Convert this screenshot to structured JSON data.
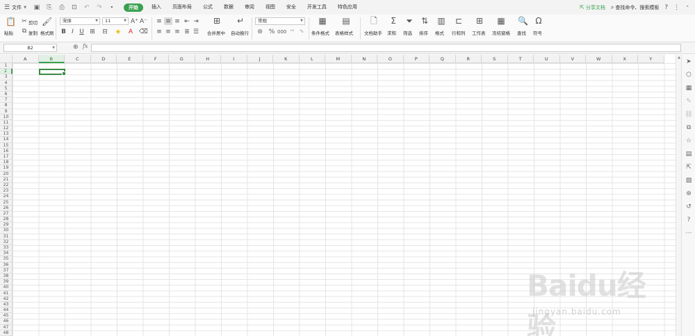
{
  "menubar": {
    "file_label": "文件",
    "tabs": [
      "开始",
      "插入",
      "页面布局",
      "公式",
      "数据",
      "审阅",
      "视图",
      "安全",
      "开发工具",
      "特色应用"
    ],
    "active_tab": "开始",
    "share_label": "分享文档",
    "search_label": "查找命令、搜索模板",
    "help_label": "?"
  },
  "ribbon": {
    "paste_label": "粘贴",
    "cut_label": "剪切",
    "copy_label": "复制",
    "format_painter_label": "格式刷",
    "font_name": "宋体",
    "font_size": "11",
    "merge_center_label": "合并居中",
    "wrap_text_label": "自动换行",
    "number_format": "常规",
    "cond_format_label": "条件格式",
    "table_style_label": "表格样式",
    "doc_helper_label": "文档助手",
    "sum_label": "求和",
    "filter_label": "筛选",
    "sort_label": "排序",
    "format_label": "格式",
    "row_col_label": "行和列",
    "worksheet_label": "工作表",
    "freeze_label": "冻结窗格",
    "find_label": "查找",
    "symbol_label": "符号"
  },
  "formula_bar": {
    "cell_ref": "B2",
    "fx_label": "fx",
    "value": ""
  },
  "sheet": {
    "columns": [
      "A",
      "B",
      "C",
      "D",
      "E",
      "F",
      "G",
      "H",
      "I",
      "J",
      "K",
      "L",
      "M",
      "N",
      "O",
      "P",
      "Q",
      "R",
      "S",
      "T",
      "U",
      "V",
      "W",
      "X",
      "Y"
    ],
    "rows": [
      "1",
      "2",
      "3",
      "4",
      "5",
      "6",
      "7",
      "8",
      "9",
      "10",
      "11",
      "12",
      "13",
      "14",
      "15",
      "16",
      "17",
      "18",
      "19",
      "20",
      "21",
      "22",
      "23",
      "24",
      "25",
      "26",
      "27",
      "28",
      "29",
      "30",
      "31",
      "32",
      "33",
      "34",
      "35",
      "36",
      "37",
      "38",
      "39",
      "40",
      "41",
      "42",
      "43",
      "44",
      "45",
      "46",
      "47",
      "48"
    ],
    "selected_column": "B",
    "selected_row": "2"
  },
  "watermark": {
    "logo": "Baidu经验",
    "url": "jingyan.baidu.com"
  },
  "colors": {
    "accent": "#3aa14f",
    "selection": "#3a8a47"
  }
}
